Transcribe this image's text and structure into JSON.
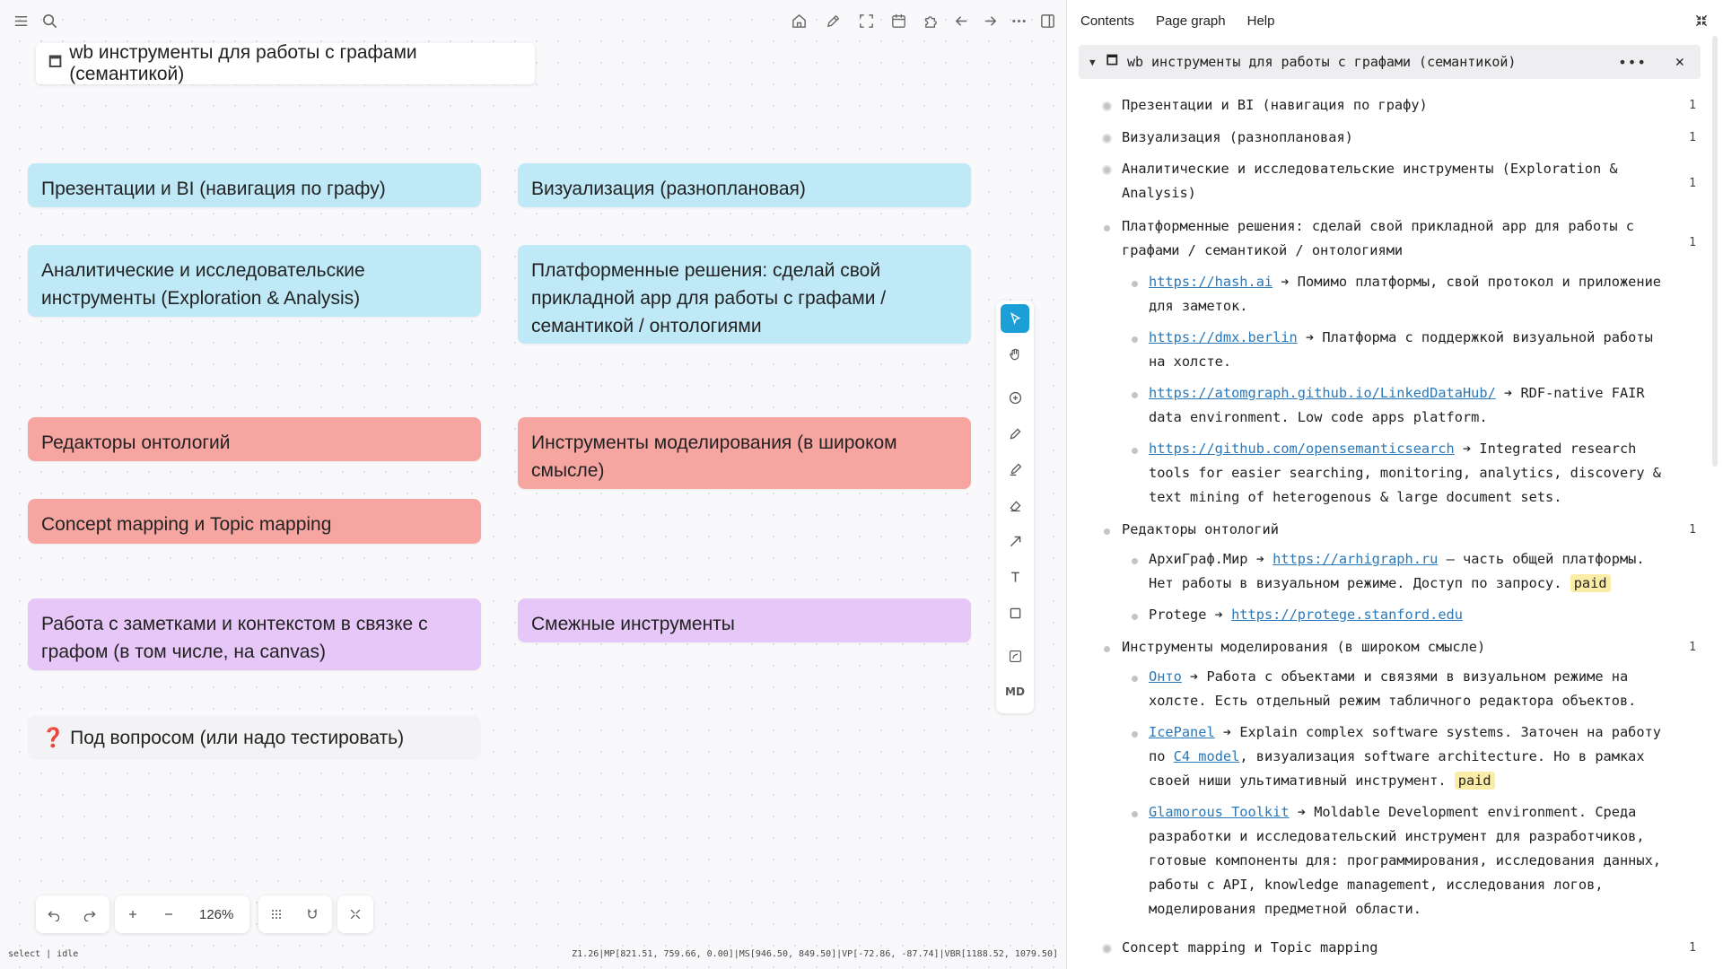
{
  "canvas": {
    "frame_title": "wb инструменты для работы с графами (семантикой)",
    "cards": [
      {
        "label": "Презентации и BI (навигация по графу)"
      },
      {
        "label": "Визуализация (разноплановая)"
      },
      {
        "label": "Аналитические и исследовательские инструменты (Exploration & Analysis)"
      },
      {
        "label": "Платформенные решения: сделай свой прикладной арр для работы с графами / семантикой / онтологиями"
      },
      {
        "label": "Редакторы онтологий"
      },
      {
        "label": "Инструменты моделирования (в широком смысле)"
      },
      {
        "label": "Concept mapping и Topic mapping"
      },
      {
        "label": "Работа с заметками и контекстом в связке с графом (в том числе, на canvas)"
      },
      {
        "label": "Смежные инструменты"
      },
      {
        "label": "Под вопросом (или надо тестировать)",
        "prefix": "❓"
      }
    ],
    "colors": {
      "blue": "#bfe9f7",
      "red": "#f7a5a1",
      "purple": "#e6c7f7",
      "accent": "#1c9ed6"
    },
    "zoom": "126%",
    "md_label": "MD",
    "status_left": "select | idle",
    "status_right": "Z1.26|MP[821.51, 759.66, 0.00]|MS[946.50, 849.50]|VP[-72.86, -87.74]|VBR[1188.52, 1079.50]"
  },
  "top_toolbar": {
    "left_icons": [
      "menu-icon",
      "search-icon"
    ],
    "right_icons": [
      "home-icon",
      "pencil-icon",
      "fullscreen-icon",
      "calendar-icon",
      "puzzle-icon",
      "arrow-left-icon",
      "arrow-right-icon",
      "more-icon",
      "sidebar-toggle-icon"
    ]
  },
  "right_panel": {
    "tabs": [
      "Contents",
      "Page graph",
      "Help"
    ],
    "header_title": "wb инструменты для работы с графами (семантикой)",
    "outline": {
      "l1": "Презентации и BI (навигация по графу)",
      "l2": "Визуализация (разноплановая)",
      "l3a": "Аналитические и исследовательские инструменты (Exploration &",
      "l3b": "Analysis)",
      "l4a": "Платформенные решения: сделай свой прикладной арр для работы с",
      "l4b": "графами / семантикой / онтологиями",
      "hash_link": "https://hash.ai",
      "hash_t1": " ➔ Помимо платформы, свой протокол и приложение",
      "hash_t2": "для заметок.",
      "dmx_link": "https://dmx.berlin",
      "dmx_t1": " ➔ Платформа с поддержкой визуальной работы",
      "dmx_t2": "на холсте.",
      "atom_link": "https://atomgraph.github.io/LinkedDataHub/",
      "atom_t1": " ➔ RDF-native FAIR",
      "atom_t2": "data environment. Low code apps platform.",
      "oss_link": "https://github.com/opensemanticsearch",
      "oss_t1": " ➔ Integrated research",
      "oss_t2": "tools for easier searching, monitoring, analytics, discovery &",
      "oss_t3": "text mining of heterogenous & large document sets.",
      "l5": "Редакторы онтологий",
      "arhi_pre": "АрхиГраф.Мир ➔ ",
      "arhi_link": "https://arhigraph.ru",
      "arhi_t1": " — часть общей платформы.",
      "arhi_t2": "Нет работы в визуальном режиме. Доступ по запросу. ",
      "paid": "paid",
      "protege_pre": "Protege ➔ ",
      "protege_link": "https://protege.stanford.edu",
      "l6": "Инструменты моделирования (в широком смысле)",
      "onto_link": "Онто",
      "onto_t1": " ➔ Работа с объектами и связями в визуальном режиме на",
      "onto_t2": "холсте. Есть отдельный режим табличного редактора объектов.",
      "ice_link": "IcePanel",
      "ice_t1": " ➔ Explain complex software systems. Заточен на работу",
      "ice_t2a": "по ",
      "c4_link": "C4 model",
      "ice_t2b": ", визуализация software architecture. Но в рамках",
      "ice_t3": "своей ниши ультимативный инструмент. ",
      "glam_link": "Glamorous Toolkit",
      "glam_t1": " ➔ Moldable Development environment. Среда",
      "glam_t2": "разработки и исследовательский инструмент для разработчиков,",
      "glam_t3": "готовые компоненты для: программирования, исследования данных,",
      "glam_t4": "работы с API, knowledge management, исследования логов,",
      "glam_t5": "моделирования предметной области.",
      "l7": "Concept mapping и Topic mapping",
      "count": "1"
    }
  }
}
